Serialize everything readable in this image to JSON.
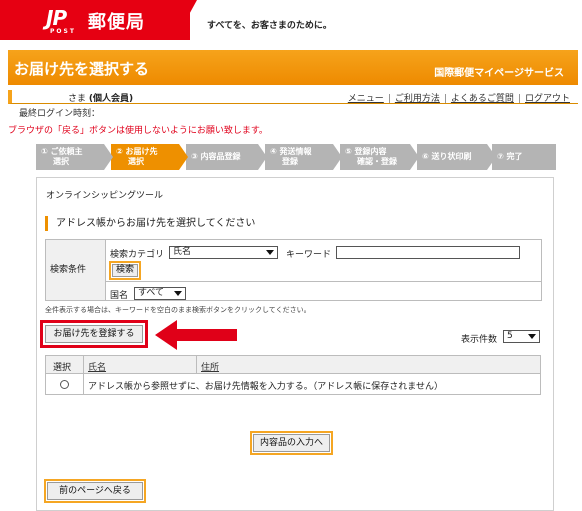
{
  "header": {
    "logo_text": "JP",
    "logo_sub": "POST",
    "brand": "郵便局",
    "tagline": "すべてを、お客さまのために。",
    "page_title": "お届け先を選択する",
    "service_name": "国際郵便マイページサービス"
  },
  "user": {
    "name_suffix": "さま",
    "member_type": "(個人会員)",
    "last_login_label": "最終ログイン時刻：",
    "links": [
      "メニュー",
      "ご利用方法",
      "よくあるご質問",
      "ログアウト"
    ],
    "warning": "ブラウザの「戻る」ボタンは使用しないようにお願い致します。"
  },
  "steps": [
    {
      "line1": "① ご依頼主",
      "line2": "選択"
    },
    {
      "line1": "② お届け先",
      "line2": "選択"
    },
    {
      "line1": "③ 内容品登録",
      "line2": ""
    },
    {
      "line1": "④ 発送情報",
      "line2": "登録"
    },
    {
      "line1": "⑤ 登録内容",
      "line2": "確認・登録"
    },
    {
      "line1": "⑥ 送り状印刷",
      "line2": ""
    },
    {
      "line1": "⑦ 完了",
      "line2": ""
    }
  ],
  "main": {
    "tool_title": "オンラインシッピングツール",
    "section_title": "アドレス帳からお届け先を選択してください",
    "search": {
      "label": "検索条件",
      "category_label": "検索カテゴリ",
      "category_value": "氏名",
      "keyword_label": "キーワード",
      "keyword_value": "",
      "search_button": "検索",
      "country_label": "国名",
      "country_value": "すべて"
    },
    "note": "全件表示する場合は、キーワードを空白のまま検索ボタンをクリックしてください。",
    "register_button": "お届け先を登録する",
    "display_count_label": "表示件数",
    "display_count_value": "5",
    "table": {
      "headers": [
        "選択",
        "氏名",
        "住所"
      ],
      "row_text": "アドレス帳から参照せずに、お届け先情報を入力する。（アドレス帳に保存されません）"
    },
    "next_button": "内容品の入力へ",
    "back_button": "前のページへ戻る"
  },
  "colors": {
    "brand_red": "#e60012",
    "accent_orange": "#ee9000",
    "highlight_red": "#e00018"
  }
}
